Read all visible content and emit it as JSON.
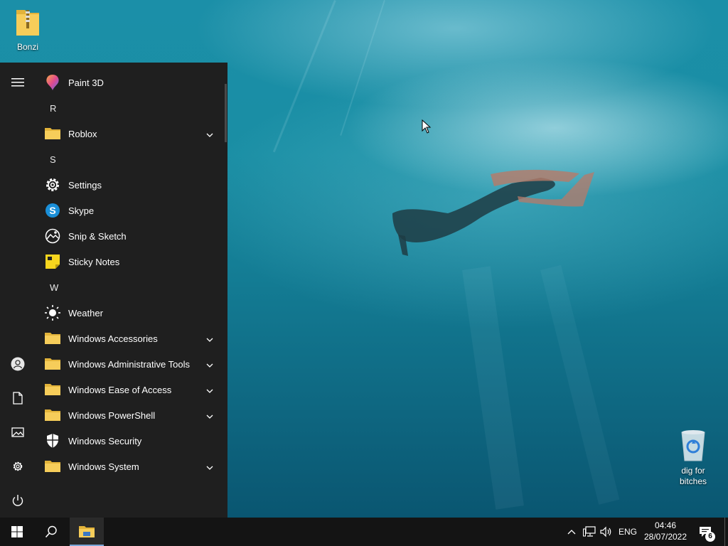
{
  "desktop": {
    "icons": [
      {
        "label": "Bonzi",
        "icon": "zip-folder-icon"
      },
      {
        "label": "dig for bitches",
        "icon": "recycle-bin-icon"
      }
    ]
  },
  "start_menu": {
    "rail": [
      "hamburger-menu-icon",
      "user-account-icon",
      "documents-icon",
      "pictures-icon",
      "settings-gear-icon",
      "power-icon"
    ],
    "apps": [
      {
        "label": "Paint 3D",
        "icon": "paint-3d-icon",
        "expandable": false
      },
      {
        "letter": "R"
      },
      {
        "label": "Roblox",
        "icon": "folder-icon",
        "expandable": true
      },
      {
        "letter": "S"
      },
      {
        "label": "Settings",
        "icon": "gear-icon",
        "expandable": false
      },
      {
        "label": "Skype",
        "icon": "skype-icon",
        "expandable": false
      },
      {
        "label": "Snip & Sketch",
        "icon": "snip-sketch-icon",
        "expandable": false
      },
      {
        "label": "Sticky Notes",
        "icon": "sticky-notes-icon",
        "expandable": false
      },
      {
        "letter": "W"
      },
      {
        "label": "Weather",
        "icon": "weather-sun-icon",
        "expandable": false
      },
      {
        "label": "Windows Accessories",
        "icon": "folder-icon",
        "expandable": true
      },
      {
        "label": "Windows Administrative Tools",
        "icon": "folder-icon",
        "expandable": true
      },
      {
        "label": "Windows Ease of Access",
        "icon": "folder-icon",
        "expandable": true
      },
      {
        "label": "Windows PowerShell",
        "icon": "folder-icon",
        "expandable": true
      },
      {
        "label": "Windows Security",
        "icon": "shield-icon",
        "expandable": false
      },
      {
        "label": "Windows System",
        "icon": "folder-icon",
        "expandable": true
      }
    ]
  },
  "taskbar": {
    "language": "ENG",
    "time": "04:46",
    "date": "28/07/2022",
    "notification_count": "6"
  },
  "colors": {
    "start_bg": "#1f1f1f",
    "taskbar_bg": "#141414",
    "folder_yellow": "#f4c542"
  }
}
